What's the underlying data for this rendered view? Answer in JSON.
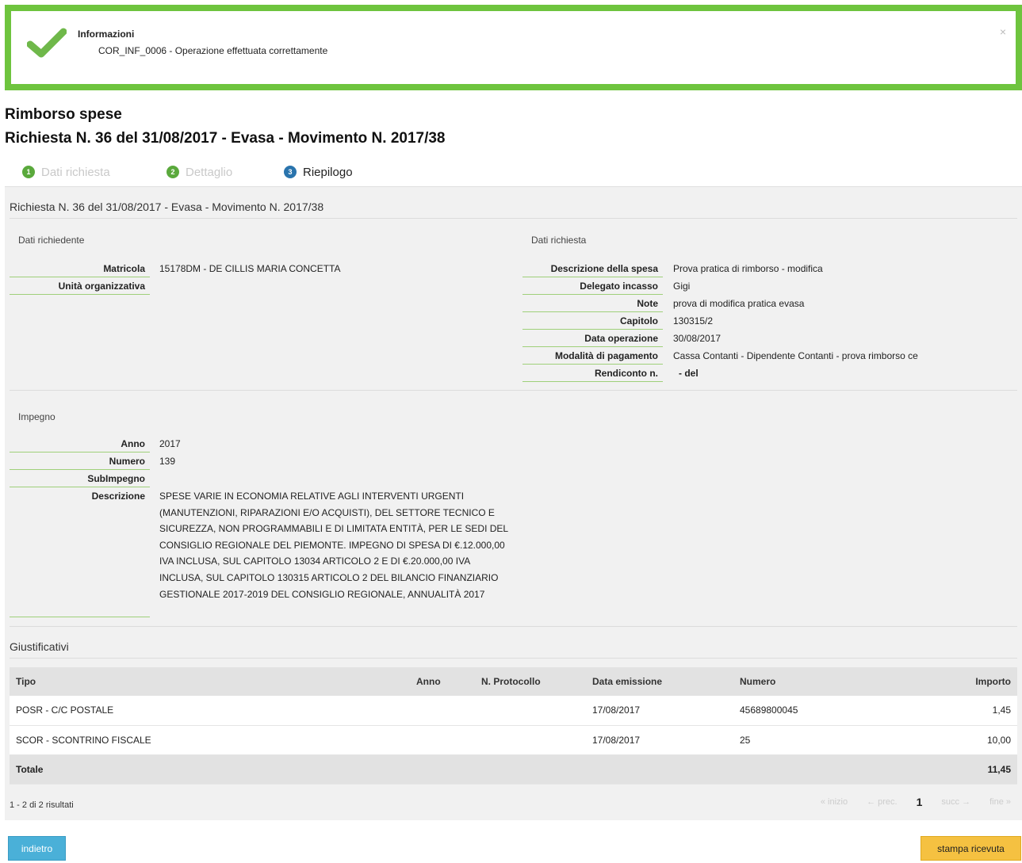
{
  "alert": {
    "title": "Informazioni",
    "message": "COR_INF_0006 - Operazione effettuata correttamente",
    "close": "×",
    "icon": "check-icon"
  },
  "header": {
    "title": "Rimborso spese",
    "subtitle": "Richiesta N. 36 del 31/08/2017 - Evasa - Movimento N. 2017/38"
  },
  "steps": [
    {
      "num": "1",
      "label": "Dati richiesta"
    },
    {
      "num": "2",
      "label": "Dettaglio"
    },
    {
      "num": "3",
      "label": "Riepilogo"
    }
  ],
  "panel": {
    "heading": "Richiesta N. 36 del 31/08/2017 - Evasa - Movimento N. 2017/38"
  },
  "richiedente": {
    "label": "Dati richiedente",
    "fields": [
      {
        "k": "Matricola",
        "v": "15178DM - DE CILLIS MARIA CONCETTA"
      },
      {
        "k": "Unità organizzativa",
        "v": ""
      }
    ]
  },
  "richiesta": {
    "label": "Dati richiesta",
    "fields": [
      {
        "k": "Descrizione della spesa",
        "v": "Prova pratica di rimborso - modifica"
      },
      {
        "k": "Delegato incasso",
        "v": "Gigi"
      },
      {
        "k": "Note",
        "v": "prova di modifica pratica evasa"
      },
      {
        "k": "Capitolo",
        "v": "130315/2"
      },
      {
        "k": "Data operazione",
        "v": "30/08/2017"
      },
      {
        "k": "Modalità di pagamento",
        "v": "Cassa Contanti - Dipendente Contanti - prova rimborso ce"
      },
      {
        "k": "Rendiconto n.",
        "v": "- del"
      }
    ]
  },
  "impegno": {
    "label": "Impegno",
    "fields": [
      {
        "k": "Anno",
        "v": "2017"
      },
      {
        "k": "Numero",
        "v": "139"
      },
      {
        "k": "SubImpegno",
        "v": ""
      }
    ],
    "desc_k": "Descrizione",
    "desc_v": "SPESE VARIE IN ECONOMIA RELATIVE AGLI INTERVENTI URGENTI (MANUTENZIONI, RIPARAZIONI E/O ACQUISTI), DEL SETTORE TECNICO E SICUREZZA, NON PROGRAMMABILI E DI LIMITATA ENTITÀ, PER LE SEDI DEL CONSIGLIO REGIONALE DEL PIEMONTE. IMPEGNO DI SPESA DI €.12.000,00 IVA INCLUSA, SUL CAPITOLO 13034 ARTICOLO 2 E DI €.20.000,00 IVA INCLUSA, SUL CAPITOLO 130315 ARTICOLO 2 DEL BILANCIO FINANZIARIO GESTIONALE 2017-2019 DEL CONSIGLIO REGIONALE, ANNUALITÀ 2017"
  },
  "giustificativi": {
    "label": "Giustificativi",
    "columns": [
      "Tipo",
      "Anno",
      "N. Protocollo",
      "Data emissione",
      "Numero",
      "Importo"
    ],
    "rows": [
      [
        "POSR - C/C POSTALE",
        "",
        "",
        "17/08/2017",
        "45689800045",
        "1,45"
      ],
      [
        "SCOR - SCONTRINO FISCALE",
        "",
        "",
        "17/08/2017",
        "25",
        "10,00"
      ]
    ],
    "total_label": "Totale",
    "total_value": "11,45",
    "results": "1 - 2 di 2 risultati",
    "pager": {
      "first": "« inizio",
      "prev": "← prec.",
      "current": "1",
      "next": "succ →",
      "last": "fine »"
    }
  },
  "buttons": {
    "back": "indietro",
    "print": "stampa ricevuta"
  },
  "colors": {
    "success": "#6ec43e",
    "step_done": "#5aa93c",
    "step_active": "#2a74ad",
    "back_button": "#4ab0d8",
    "print_button": "#f5c141"
  }
}
